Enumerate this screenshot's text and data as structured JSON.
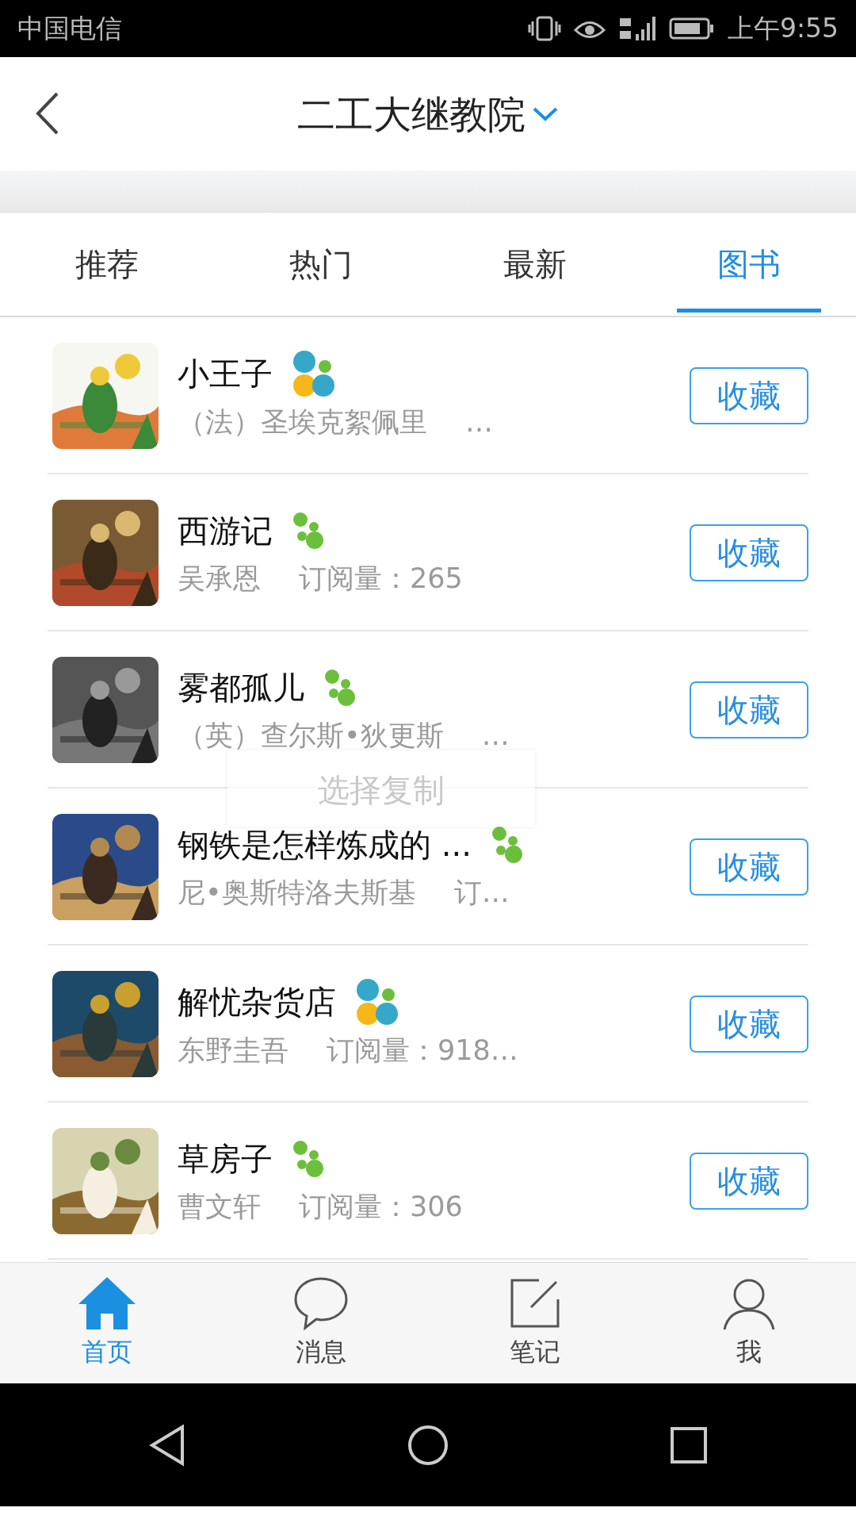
{
  "status_bar": {
    "carrier": "中国电信",
    "time": "上午9:55"
  },
  "header": {
    "title": "二工大继教院"
  },
  "tabs": [
    {
      "label": "推荐",
      "selected": false
    },
    {
      "label": "热门",
      "selected": false
    },
    {
      "label": "最新",
      "selected": false
    },
    {
      "label": "图书",
      "selected": true
    }
  ],
  "books": [
    {
      "title": "小王子",
      "kind": "multicolor",
      "author": "（法）圣埃克絮佩里",
      "meta": "…",
      "button": "收藏"
    },
    {
      "title": "西游记",
      "kind": "green",
      "author": "吴承恩",
      "meta": "订阅量：265",
      "button": "收藏"
    },
    {
      "title": "雾都孤儿",
      "kind": "green",
      "author": "（英）查尔斯•狄更斯",
      "meta": "…",
      "button": "收藏"
    },
    {
      "title": "钢铁是怎样炼成的 ...",
      "kind": "green",
      "author": "尼•奥斯特洛夫斯基",
      "meta": "订…",
      "button": "收藏"
    },
    {
      "title": "解忧杂货店",
      "kind": "multicolor",
      "author": "东野圭吾",
      "meta": "订阅量：918…",
      "button": "收藏"
    },
    {
      "title": "草房子",
      "kind": "green",
      "author": "曹文轩",
      "meta": "订阅量：306",
      "button": "收藏"
    }
  ],
  "popup": {
    "label": "选择复制"
  },
  "bottom_nav": [
    {
      "label": "首页",
      "selected": true
    },
    {
      "label": "消息",
      "selected": false
    },
    {
      "label": "笔记",
      "selected": false
    },
    {
      "label": "我",
      "selected": false
    }
  ]
}
